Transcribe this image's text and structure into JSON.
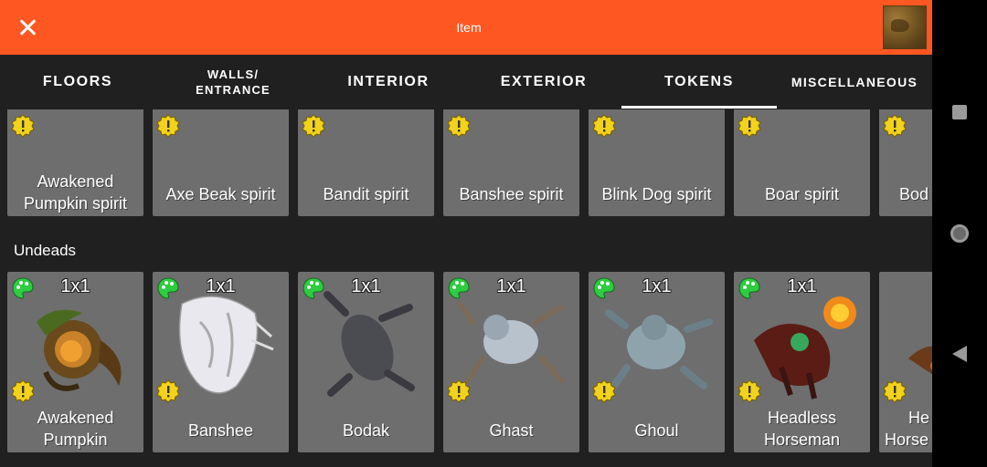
{
  "appbar": {
    "title": "Item"
  },
  "tabs": [
    {
      "label": "FLOORS"
    },
    {
      "label": "WALLS/\nENTRANCE"
    },
    {
      "label": "INTERIOR"
    },
    {
      "label": "EXTERIOR"
    },
    {
      "label": "TOKENS",
      "selected": true
    },
    {
      "label": "MISCELLANEOUS"
    }
  ],
  "spirits": [
    {
      "line1": "Awakened",
      "line2": "Pumpkin spirit"
    },
    {
      "line1": "Axe Beak spirit"
    },
    {
      "line1": "Bandit spirit"
    },
    {
      "line1": "Banshee spirit"
    },
    {
      "line1": "Blink Dog spirit"
    },
    {
      "line1": "Boar spirit"
    },
    {
      "line1": "Bod"
    }
  ],
  "section": {
    "undeads": "Undeads"
  },
  "undeads": [
    {
      "size": "1x1",
      "line1": "Awakened",
      "line2": "Pumpkin"
    },
    {
      "size": "1x1",
      "line1": "Banshee"
    },
    {
      "size": "1x1",
      "line1": "Bodak"
    },
    {
      "size": "1x1",
      "line1": "Ghast"
    },
    {
      "size": "1x1",
      "line1": "Ghoul"
    },
    {
      "size": "1x1",
      "line1": "Headless",
      "line2": "Horseman"
    },
    {
      "line1": "He",
      "line2": "Horse"
    }
  ],
  "colors": {
    "appbar": "#ff5722",
    "background": "#202020",
    "card": "#6e6e6e",
    "warning_badge": "#f2d21b",
    "palette_badge": "#2ecc40"
  },
  "icons": {
    "close": "close-icon",
    "warning": "warning-badge-icon",
    "palette": "palette-icon"
  }
}
